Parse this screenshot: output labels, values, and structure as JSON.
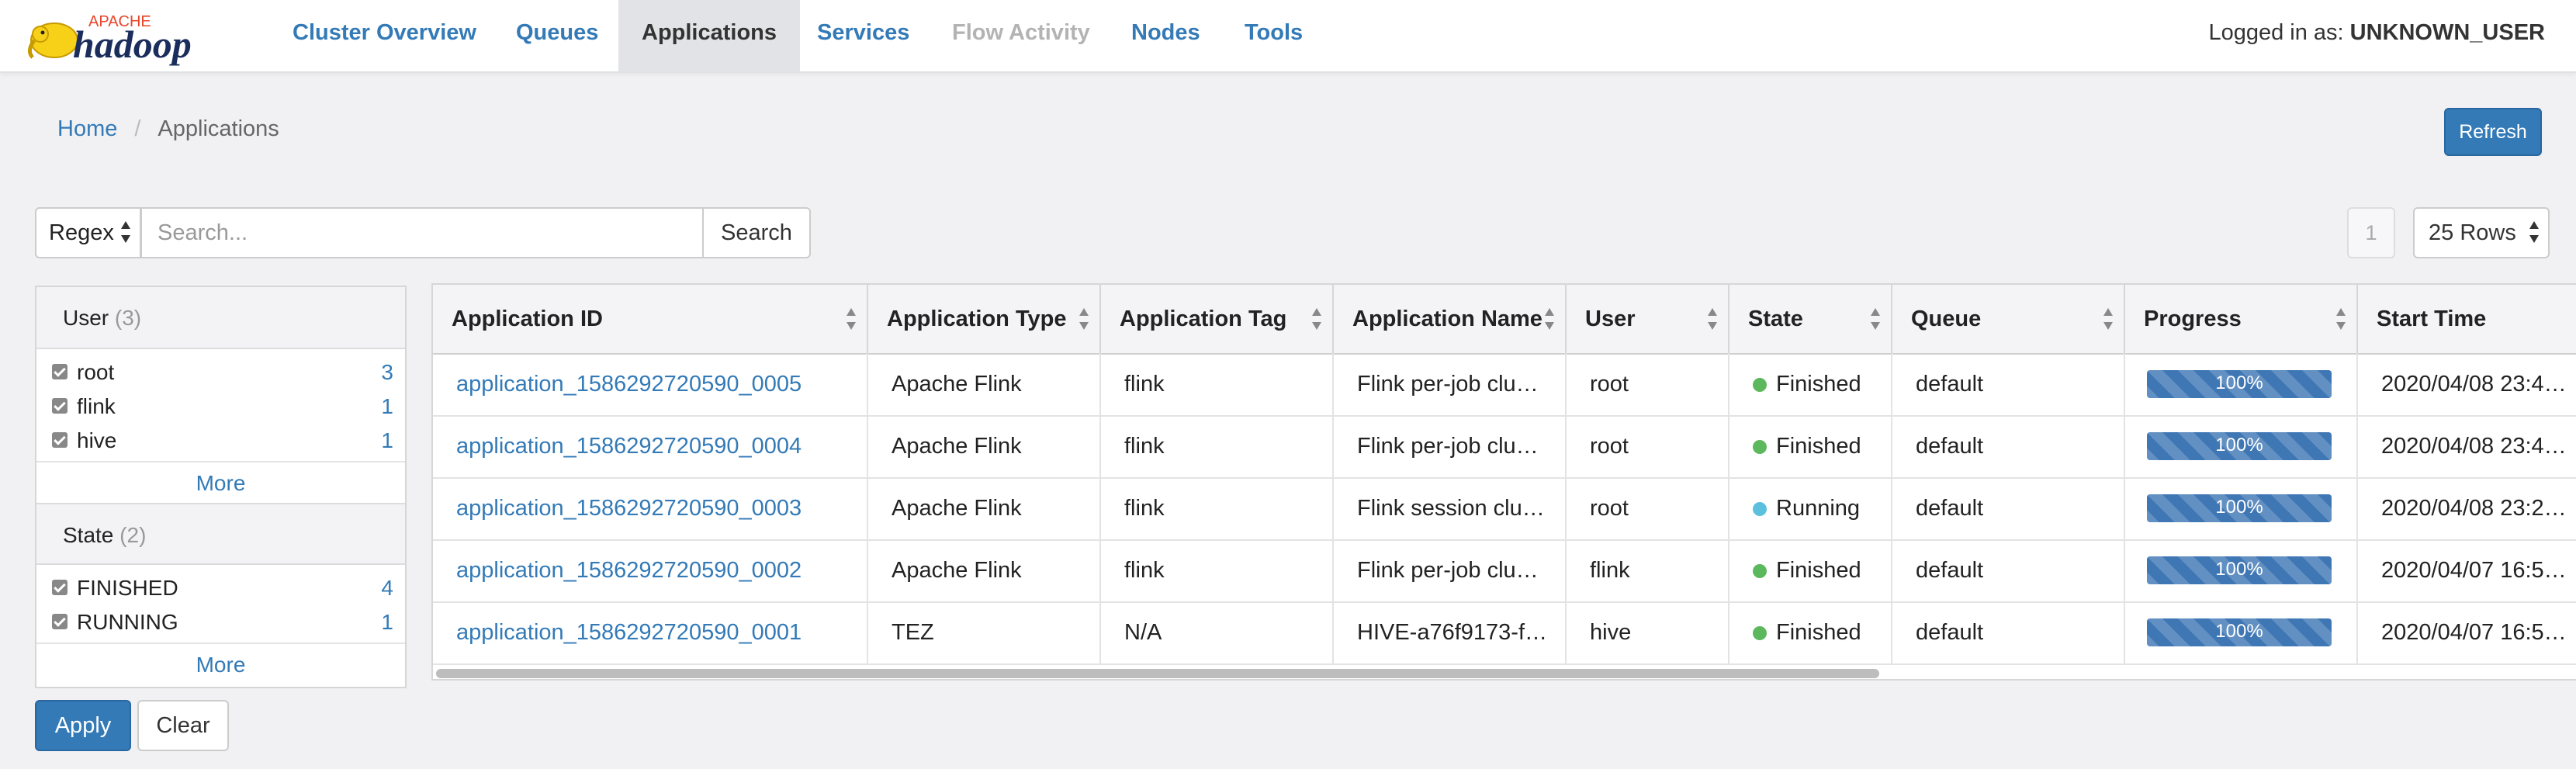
{
  "nav": {
    "logo_text": "APACHE hadoop",
    "items": [
      {
        "label": "Cluster Overview",
        "state": "normal"
      },
      {
        "label": "Queues",
        "state": "normal"
      },
      {
        "label": "Applications",
        "state": "active"
      },
      {
        "label": "Services",
        "state": "normal"
      },
      {
        "label": "Flow Activity",
        "state": "disabled"
      },
      {
        "label": "Nodes",
        "state": "normal"
      },
      {
        "label": "Tools",
        "state": "normal"
      }
    ],
    "login_prefix": "Logged in as: ",
    "login_user": "UNKNOWN_USER"
  },
  "breadcrumb": {
    "home": "Home",
    "separator": "/",
    "current": "Applications"
  },
  "toolbar": {
    "refresh_label": "Refresh",
    "search_mode": "Regex",
    "search_placeholder": "Search...",
    "search_label": "Search",
    "page_number": "1",
    "rows_per_page": "25 Rows"
  },
  "facets": [
    {
      "title": "User",
      "count": "(3)",
      "options": [
        {
          "label": "root",
          "count": "3",
          "checked": true
        },
        {
          "label": "flink",
          "count": "1",
          "checked": true
        },
        {
          "label": "hive",
          "count": "1",
          "checked": true
        }
      ],
      "more_label": "More"
    },
    {
      "title": "State",
      "count": "(2)",
      "options": [
        {
          "label": "FINISHED",
          "count": "4",
          "checked": true
        },
        {
          "label": "RUNNING",
          "count": "1",
          "checked": true
        }
      ],
      "more_label": "More"
    }
  ],
  "actions": {
    "apply_label": "Apply",
    "clear_label": "Clear"
  },
  "table": {
    "columns": [
      "Application ID",
      "Application Type",
      "Application Tag",
      "Application Name",
      "User",
      "State",
      "Queue",
      "Progress",
      "Start Time"
    ],
    "rows": [
      {
        "id": "application_1586292720590_0005",
        "type": "Apache Flink",
        "tag": "flink",
        "name": "Flink per-job clu…",
        "user": "root",
        "state": "Finished",
        "state_color": "#5cb85c",
        "queue": "default",
        "progress_label": "100%",
        "progress": 1.0,
        "start": "2020/04/08 23:4…"
      },
      {
        "id": "application_1586292720590_0004",
        "type": "Apache Flink",
        "tag": "flink",
        "name": "Flink per-job clu…",
        "user": "root",
        "state": "Finished",
        "state_color": "#5cb85c",
        "queue": "default",
        "progress_label": "100%",
        "progress": 1.0,
        "start": "2020/04/08 23:4…"
      },
      {
        "id": "application_1586292720590_0003",
        "type": "Apache Flink",
        "tag": "flink",
        "name": "Flink session clu…",
        "user": "root",
        "state": "Running",
        "state_color": "#5bc0de",
        "queue": "default",
        "progress_label": "100%",
        "progress": 1.0,
        "start": "2020/04/08 23:2…"
      },
      {
        "id": "application_1586292720590_0002",
        "type": "Apache Flink",
        "tag": "flink",
        "name": "Flink per-job clu…",
        "user": "flink",
        "state": "Finished",
        "state_color": "#5cb85c",
        "queue": "default",
        "progress_label": "100%",
        "progress": 1.0,
        "start": "2020/04/07 16:5…"
      },
      {
        "id": "application_1586292720590_0001",
        "type": "TEZ",
        "tag": "N/A",
        "name": "HIVE-a76f9173-f…",
        "user": "hive",
        "state": "Finished",
        "state_color": "#5cb85c",
        "queue": "default",
        "progress_label": "100%",
        "progress": 1.0,
        "start": "2020/04/07 16:5…"
      }
    ]
  },
  "colors": {
    "link": "#337ab7",
    "primary_button": "#337ab7",
    "finished": "#5cb85c",
    "running": "#5bc0de"
  }
}
